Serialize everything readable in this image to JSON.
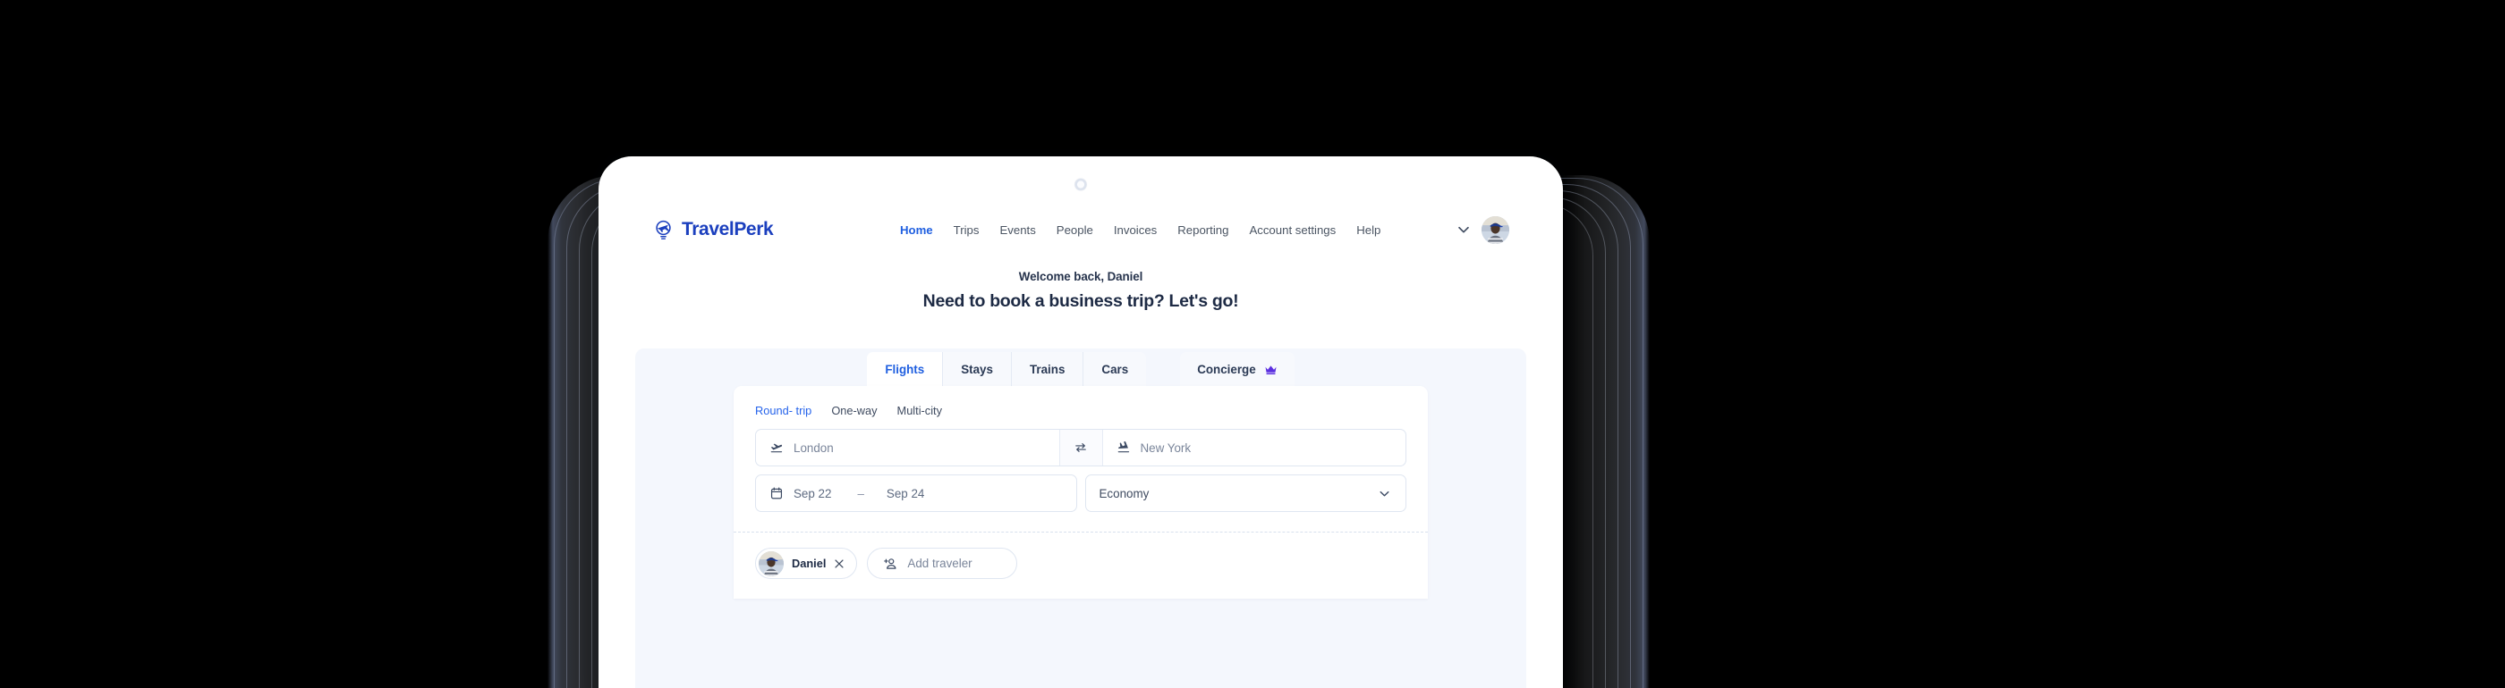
{
  "brand": {
    "name": "TravelPerk",
    "logo_icon": "lightbulb-airplane-icon",
    "logo_color": "#1b3fbe",
    "accent_color": "#1f5fe0"
  },
  "header": {
    "nav": [
      {
        "label": "Home",
        "active": true
      },
      {
        "label": "Trips",
        "active": false
      },
      {
        "label": "Events",
        "active": false
      },
      {
        "label": "People",
        "active": false
      },
      {
        "label": "Invoices",
        "active": false
      },
      {
        "label": "Reporting",
        "active": false
      },
      {
        "label": "Account settings",
        "active": false
      },
      {
        "label": "Help",
        "active": false
      }
    ],
    "chevron_icon": "chevron-down-icon",
    "avatar_icon": "user-avatar-photo"
  },
  "welcome": {
    "greeting": "Welcome back, Daniel",
    "headline": "Need to book a business trip? Let's go!"
  },
  "tabs": [
    {
      "label": "Flights",
      "active": true
    },
    {
      "label": "Stays",
      "active": false
    },
    {
      "label": "Trains",
      "active": false
    },
    {
      "label": "Cars",
      "active": false
    }
  ],
  "concierge_tab": {
    "label": "Concierge",
    "icon": "crown-icon",
    "icon_color": "#5b2fe0"
  },
  "search": {
    "trip_types": [
      {
        "label": "Round- trip",
        "active": true
      },
      {
        "label": "One-way",
        "active": false
      },
      {
        "label": "Multi-city",
        "active": false
      }
    ],
    "origin": {
      "value": "London",
      "placeholder": "London",
      "icon": "flight-takeoff-icon"
    },
    "destination": {
      "value": "New York",
      "placeholder": "New York",
      "icon": "flight-landing-icon"
    },
    "swap_icon": "swap-arrows-icon",
    "dates": {
      "icon": "calendar-icon",
      "start": "Sep 22",
      "separator": "–",
      "end": "Sep 24"
    },
    "cabin": {
      "value": "Economy",
      "chevron_icon": "chevron-down-icon"
    },
    "travelers": [
      {
        "name": "Daniel",
        "remove_icon": "close-icon",
        "avatar": "user-avatar-photo"
      }
    ],
    "add_traveler": {
      "label": "Add traveler",
      "icon": "add-person-icon"
    }
  },
  "device": {
    "camera_icon": "camera-sensor-dot"
  }
}
